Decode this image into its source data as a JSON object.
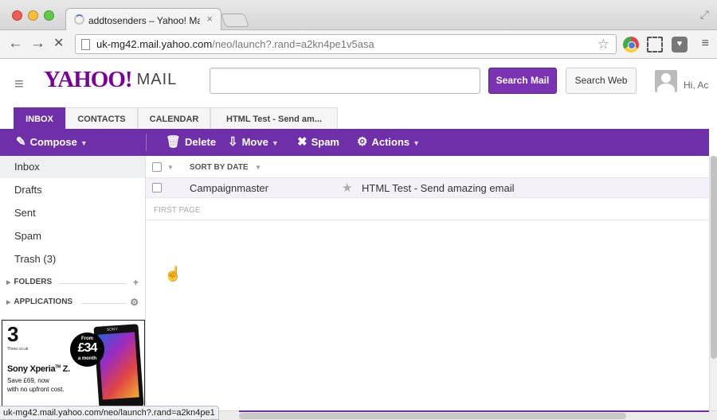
{
  "browser": {
    "tab_title": "addtosenders – Yahoo! Ma",
    "tab_close": "×",
    "url_host": "uk-mg42.mail.yahoo.com",
    "url_path": "/neo/launch?.rand=a2kn4pe1v5asa",
    "status_url": "uk-mg42.mail.yahoo.com/neo/launch?.rand=a2kn4pe1",
    "back": "←",
    "forward": "→",
    "stop": "✕",
    "star": "☆",
    "menu": "≡",
    "fullscreen": "⤢",
    "pocket": "♥"
  },
  "header": {
    "logo": "YAHOO!",
    "logo_mail": "MAIL",
    "hamburger": "≡",
    "search_placeholder": "",
    "search_mail_label": "Search Mail",
    "search_web_label": "Search Web",
    "greeting": "Hi, Ac"
  },
  "tabs": [
    {
      "label": "INBOX",
      "active": true
    },
    {
      "label": "CONTACTS",
      "active": false
    },
    {
      "label": "CALENDAR",
      "active": false
    },
    {
      "label": "HTML Test - Send am...",
      "active": false
    }
  ],
  "actions": {
    "compose": "Compose",
    "delete": "Delete",
    "move": "Move",
    "spam": "Spam",
    "actions": "Actions",
    "compose_icon": "✎",
    "delete_icon": "🗑",
    "move_icon": "⇩",
    "spam_icon": "✖",
    "actions_icon": "⚙",
    "caret": "▼"
  },
  "folders": [
    {
      "label": "Inbox",
      "selected": true
    },
    {
      "label": "Drafts",
      "selected": false
    },
    {
      "label": "Sent",
      "selected": false
    },
    {
      "label": "Spam",
      "selected": false
    },
    {
      "label": "Trash (3)",
      "selected": false
    }
  ],
  "sections": {
    "folders": "FOLDERS",
    "applications": "APPLICATIONS",
    "triangle": "▶",
    "add": "+",
    "gear": "⚙"
  },
  "ad": {
    "logo": "3",
    "logo_sub": "Three.co.uk",
    "badge_from": "From",
    "badge_price": "£34",
    "badge_period": "a month",
    "phone_brand": "SONY",
    "title": "Sony Xperia",
    "title_sup": "TM",
    "title_model": " Z.",
    "line1": "Save £69, now",
    "line2": "with no upfront cost."
  },
  "list": {
    "sort_label": "SORT BY DATE",
    "sort_caret": "▼",
    "messages": [
      {
        "from": "Campaignmaster",
        "star": "★",
        "subject": "HTML Test - Send amazing email"
      }
    ],
    "first_page": "FIRST PAGE"
  },
  "cursor": "☝"
}
